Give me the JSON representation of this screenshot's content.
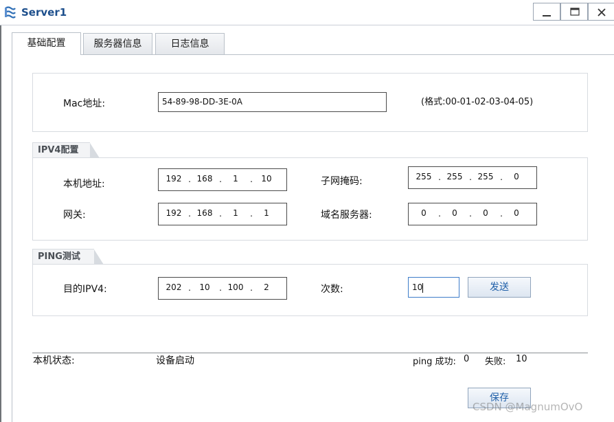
{
  "window": {
    "title": "Server1",
    "minimize_glyph": "_",
    "maximize_glyph": "□",
    "close_glyph": "X"
  },
  "tabs": [
    {
      "label": "基础配置",
      "active": true
    },
    {
      "label": "服务器信息",
      "active": false
    },
    {
      "label": "日志信息",
      "active": false
    }
  ],
  "mac": {
    "label": "Mac地址:",
    "value": "54-89-98-DD-3E-0A",
    "format_hint": "(格式:00-01-02-03-04-05)"
  },
  "ipv4": {
    "section_title": "IPV4配置",
    "local_ip": {
      "label": "本机地址:",
      "octets": [
        "192",
        "168",
        "1",
        "10"
      ]
    },
    "subnet_mask": {
      "label": "子网掩码:",
      "octets": [
        "255",
        "255",
        "255",
        "0"
      ]
    },
    "gateway": {
      "label": "网关:",
      "octets": [
        "192",
        "168",
        "1",
        "1"
      ]
    },
    "dns": {
      "label": "域名服务器:",
      "octets": [
        "0",
        "0",
        "0",
        "0"
      ]
    }
  },
  "ping": {
    "section_title": "PING测试",
    "dest_label": "目的IPV4:",
    "dest_octets": [
      "202",
      "10",
      "100",
      "2"
    ],
    "count_label": "次数:",
    "count_value": "10",
    "send_button": "发送"
  },
  "status": {
    "label": "本机状态:",
    "value": "设备启动",
    "ping_success_label": "ping 成功:",
    "ping_success_value": "0",
    "fail_label": "失败:",
    "fail_value": "10"
  },
  "save_button": "保存",
  "watermark": "CSDN @MagnumOvO",
  "icons": {
    "app": "server-icon",
    "minimize": "minimize-icon",
    "maximize": "maximize-icon",
    "close": "close-icon"
  },
  "colors": {
    "title_text": "#1d4f8c",
    "button_text": "#1f5fa8",
    "focus_border": "#3d7cc9"
  }
}
